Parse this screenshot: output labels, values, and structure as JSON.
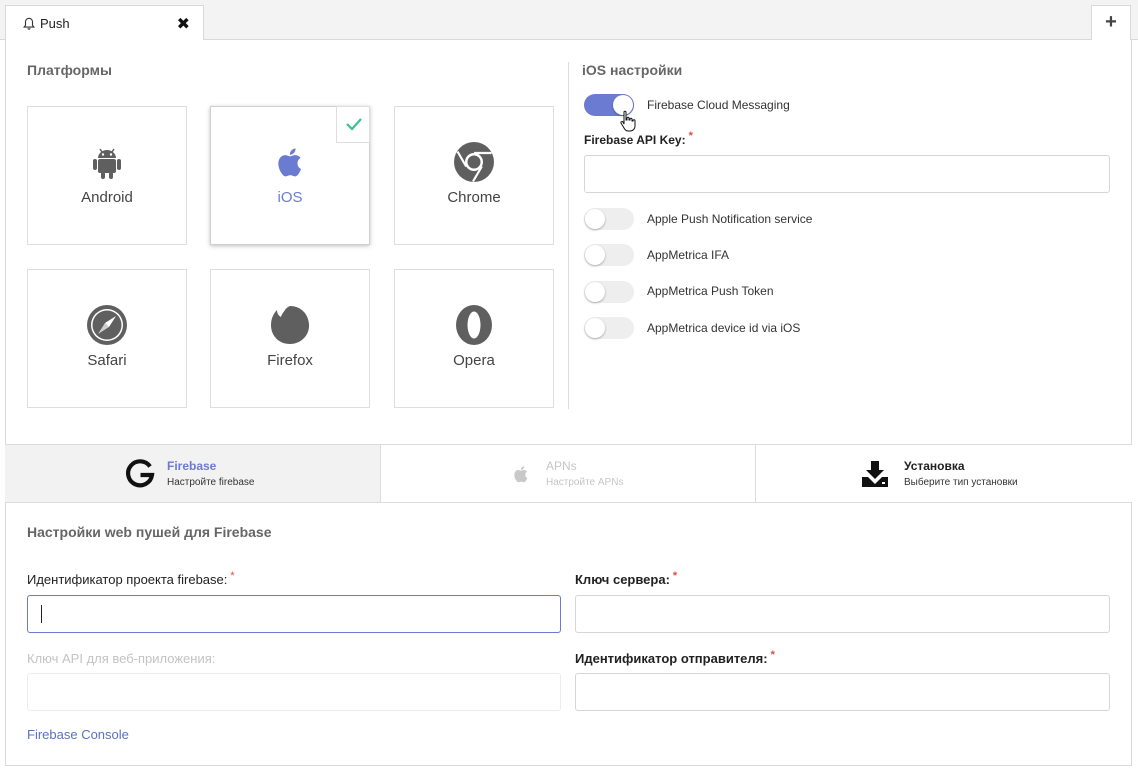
{
  "tab": {
    "title": "Push"
  },
  "platforms": {
    "title": "Платформы",
    "items": [
      {
        "name": "Android",
        "selected": false
      },
      {
        "name": "iOS",
        "selected": true
      },
      {
        "name": "Chrome",
        "selected": false
      },
      {
        "name": "Safari",
        "selected": false
      },
      {
        "name": "Firefox",
        "selected": false
      },
      {
        "name": "Opera",
        "selected": false
      }
    ]
  },
  "ios_settings": {
    "title": "iOS настройки",
    "fcm_toggle": {
      "label": "Firebase Cloud Messaging",
      "on": true
    },
    "api_key": {
      "label": "Firebase API Key:",
      "value": ""
    },
    "toggles": [
      {
        "label": "Apple Push Notification service",
        "on": false
      },
      {
        "label": "AppMetrica IFA",
        "on": false
      },
      {
        "label": "AppMetrica Push Token",
        "on": false
      },
      {
        "label": "AppMetrica device id via iOS",
        "on": false
      }
    ]
  },
  "steps": [
    {
      "title": "Firebase",
      "subtitle": "Настройте firebase",
      "state": "active"
    },
    {
      "title": "APNs",
      "subtitle": "Настройте APNs",
      "state": "disabled"
    },
    {
      "title": "Установка",
      "subtitle": "Выберите тип установки",
      "state": "normal"
    }
  ],
  "firebase": {
    "title": "Настройки web пушей для Firebase",
    "project_id": {
      "label": "Идентификатор проекта firebase:",
      "value": ""
    },
    "web_api_key": {
      "label": "Ключ API для веб-приложения:",
      "value": ""
    },
    "server_key": {
      "label": "Ключ сервера:",
      "value": ""
    },
    "sender_id": {
      "label": "Идентификатор отправителя:",
      "value": ""
    },
    "console_link": "Firebase Console"
  },
  "colors": {
    "accent": "#6b7bd1",
    "icon_gray": "#5f5f5f",
    "check": "#3fbf93",
    "required": "#e34a4a"
  },
  "required_mark": "*"
}
